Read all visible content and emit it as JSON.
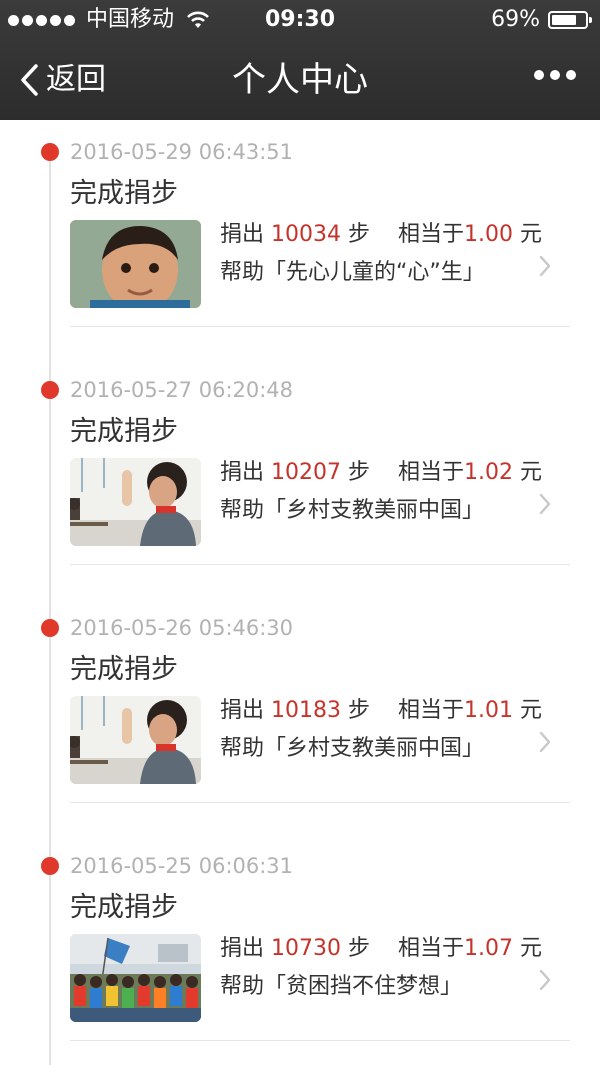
{
  "status_bar": {
    "carrier": "中国移动",
    "time": "09:30",
    "battery": "69%",
    "icons": [
      "signal-dots-icon",
      "wifi-icon",
      "battery-icon"
    ]
  },
  "nav": {
    "back_label": "返回",
    "title": "个人中心",
    "more_icon": "more-dots-icon"
  },
  "colors": {
    "accent_red": "#c6332a",
    "timeline_dot": "#e0392b",
    "nav_background": "#2f2f2f"
  },
  "entries": [
    {
      "time": "2016-05-29 06:43:51",
      "title": "完成捐步",
      "donate_prefix": "捐出",
      "steps": "10034",
      "steps_unit": "步",
      "equiv_prefix": "相当于",
      "amount": "1.00",
      "amount_unit": "元",
      "help_text": "帮助「先心儿童的“心”生」",
      "image": "child-portrait-photo"
    },
    {
      "time": "2016-05-27 06:20:48",
      "title": "完成捐步",
      "donate_prefix": "捐出",
      "steps": "10207",
      "steps_unit": "步",
      "equiv_prefix": "相当于",
      "amount": "1.02",
      "amount_unit": "元",
      "help_text": "帮助「乡村支教美丽中国」",
      "image": "classroom-raised-hand-photo"
    },
    {
      "time": "2016-05-26 05:46:30",
      "title": "完成捐步",
      "donate_prefix": "捐出",
      "steps": "10183",
      "steps_unit": "步",
      "equiv_prefix": "相当于",
      "amount": "1.01",
      "amount_unit": "元",
      "help_text": "帮助「乡村支教美丽中国」",
      "image": "classroom-raised-hand-photo"
    },
    {
      "time": "2016-05-25 06:06:31",
      "title": "完成捐步",
      "donate_prefix": "捐出",
      "steps": "10730",
      "steps_unit": "步",
      "equiv_prefix": "相当于",
      "amount": "1.07",
      "amount_unit": "元",
      "help_text": "帮助「贫困挡不住梦想」",
      "image": "children-group-flag-photo"
    }
  ]
}
